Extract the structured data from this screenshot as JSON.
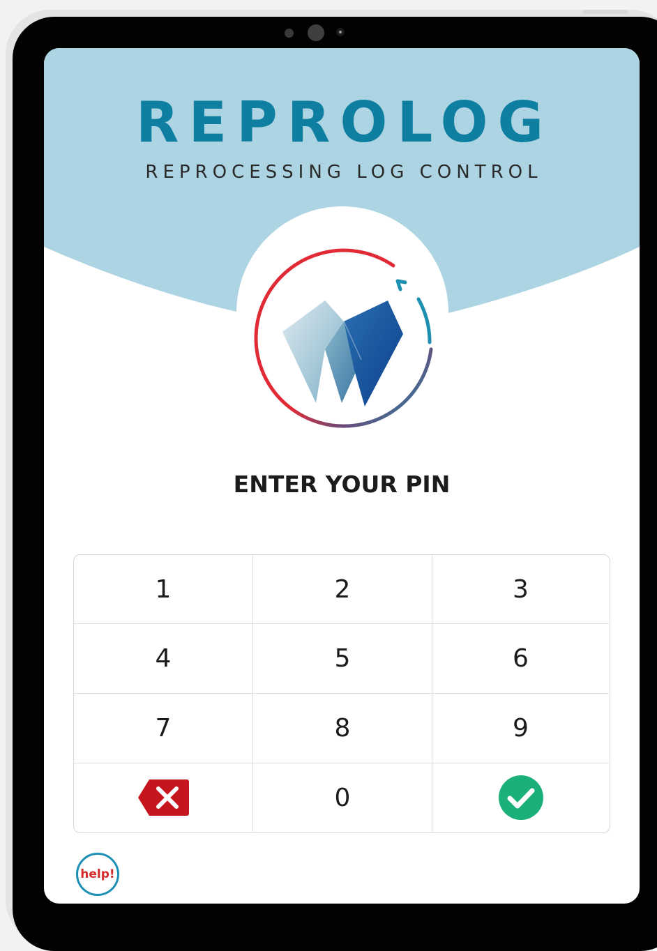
{
  "header": {
    "title": "REPROLOG",
    "subtitle": "REPROCESSING LOG CONTROL"
  },
  "colors": {
    "header_background": "#add4e2",
    "brand_teal": "#0e7fa0",
    "ring_red": "#e02a35",
    "delete_red": "#c5161f",
    "confirm_green": "#1bb07a"
  },
  "login": {
    "heading": "ENTER YOUR PIN"
  },
  "keypad": {
    "keys": [
      "1",
      "2",
      "3",
      "4",
      "5",
      "6",
      "7",
      "8",
      "9",
      "0"
    ],
    "delete_icon": "close-icon",
    "confirm_icon": "check-icon"
  },
  "help": {
    "label": "help!"
  }
}
